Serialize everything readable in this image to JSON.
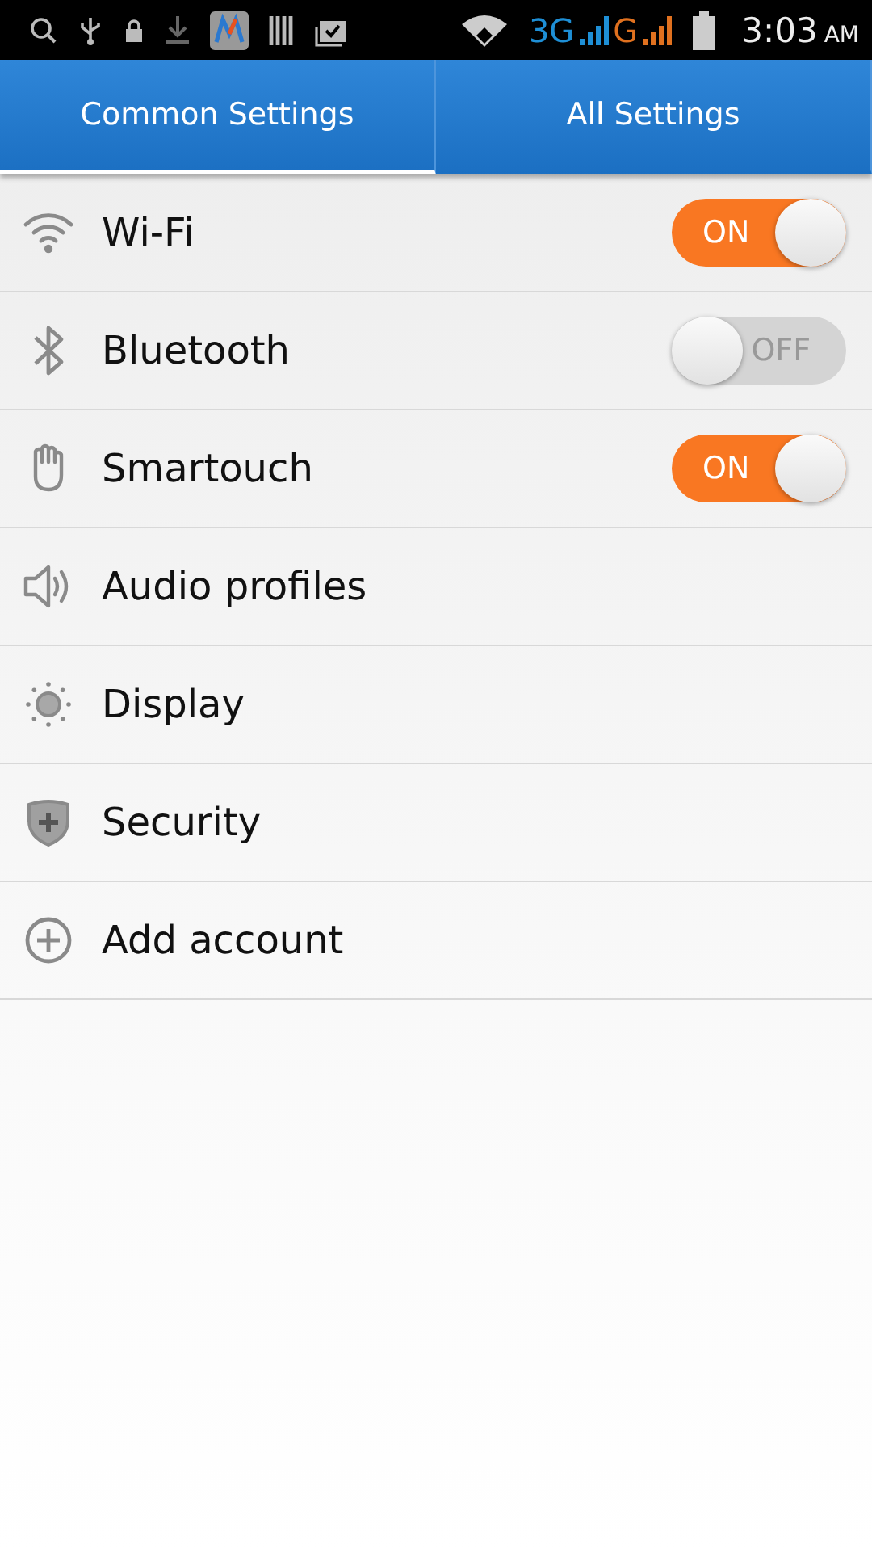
{
  "status_bar": {
    "network_3g": "3G",
    "network_g": "G",
    "time": "3:03",
    "meridiem": "AM"
  },
  "tabs": [
    {
      "label": "Common Settings",
      "selected": true
    },
    {
      "label": "All Settings",
      "selected": false
    }
  ],
  "settings": [
    {
      "label": "Wi-Fi",
      "kind": "switch",
      "on": true,
      "switch_text": "ON"
    },
    {
      "label": "Bluetooth",
      "kind": "switch",
      "on": false,
      "switch_text": "OFF"
    },
    {
      "label": "Smartouch",
      "kind": "switch",
      "on": true,
      "switch_text": "ON"
    },
    {
      "label": "Audio profiles",
      "kind": "link"
    },
    {
      "label": "Display",
      "kind": "link"
    },
    {
      "label": "Security",
      "kind": "link"
    },
    {
      "label": "Add account",
      "kind": "link"
    }
  ]
}
